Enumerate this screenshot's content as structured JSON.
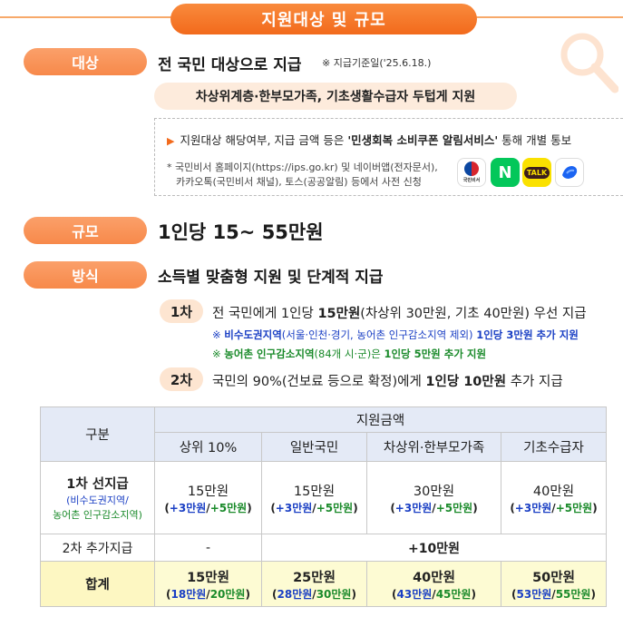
{
  "header": {
    "title": "지원대상 및 규모"
  },
  "sections": {
    "target_label": "대상",
    "target_text": "전 국민 대상으로 지급",
    "target_note": "※ 지급기준일('25.6.18.)",
    "target_sub": "차상위계층·한부모가족, 기초생활수급자 두텁게 지원",
    "scale_label": "규모",
    "scale_text": "1인당 15~ 55만원",
    "method_label": "방식",
    "method_text": "소득별 맞춤형 지원 및 단계적 지급"
  },
  "notice": {
    "line_pre": "지원대상 해당여부, 지급 금액 등은 ",
    "line_bold": "'민생회복 소비쿠폰 알림서비스'",
    "line_post": " 통해 개별 통보",
    "detail_1": "* 국민비서 홈페이지(https://ips.go.kr) 및 네이버앱(전자문서),",
    "detail_2": "카카오톡(국민비서 채널), 토스(공공알림) 등에서 사전 신청",
    "icons": [
      {
        "name": "gov-icon",
        "caption": "국민비서"
      },
      {
        "name": "naver-icon",
        "text": "N",
        "color": "#03c75a"
      },
      {
        "name": "kakaotalk-icon",
        "text": "TALK",
        "color": "#fae100"
      },
      {
        "name": "toss-icon",
        "color": "#1b64f2"
      }
    ]
  },
  "steps": {
    "step1_label": "1차",
    "step1_pre": "전 국민에게 1인당 ",
    "step1_bold": "15만원",
    "step1_post": "(차상위 30만원, 기초 40만원) 우선 지급",
    "blue_pre": "※ ",
    "blue_bold": "비수도권지역",
    "blue_mid": "(서울·인천·경기, 농어촌 인구감소지역 제외) ",
    "blue_bold2": "1인당 3만원 추가 지원",
    "green_pre": "※ ",
    "green_bold": "농어촌 인구감소지역",
    "green_mid": "(84개 시·군)은 ",
    "green_bold2": "1인당 5만원 추가 지원",
    "step2_label": "2차",
    "step2_pre": "국민의 90%(건보료 등으로 확정)에게 ",
    "step2_bold": "1인당 10만원",
    "step2_post": " 추가 지급"
  },
  "table": {
    "col_category": "구분",
    "col_group": "지원금액",
    "columns": [
      "상위 10%",
      "일반국민",
      "차상위·한부모가족",
      "기초수급자"
    ],
    "row1": {
      "head": "1차 선지급",
      "head_blue": "(비수도권지역/",
      "head_green": "농어촌 인구감소지역)",
      "cells": [
        {
          "amount": "15만원",
          "b1": "+3만원",
          "b2": "+5만원"
        },
        {
          "amount": "15만원",
          "b1": "+3만원",
          "b2": "+5만원"
        },
        {
          "amount": "30만원",
          "b1": "+3만원",
          "b2": "+5만원"
        },
        {
          "amount": "40만원",
          "b1": "+3만원",
          "b2": "+5만원"
        }
      ]
    },
    "row2": {
      "head": "2차 추가지급",
      "top10": "-",
      "rest": "+10만원"
    },
    "total": {
      "head": "합계",
      "cells": [
        {
          "amount": "15만원",
          "a": "18만원",
          "b": "20만원"
        },
        {
          "amount": "25만원",
          "a": "28만원",
          "b": "30만원"
        },
        {
          "amount": "40만원",
          "a": "43만원",
          "b": "45만원"
        },
        {
          "amount": "50만원",
          "a": "53만원",
          "b": "55만원"
        }
      ]
    }
  },
  "colors": {
    "accent_orange": "#f26a1c",
    "blue": "#1a3fc4",
    "green": "#1a8a2a",
    "header_bg": "#e4eaf6",
    "total_bg": "#fdfbd3"
  }
}
